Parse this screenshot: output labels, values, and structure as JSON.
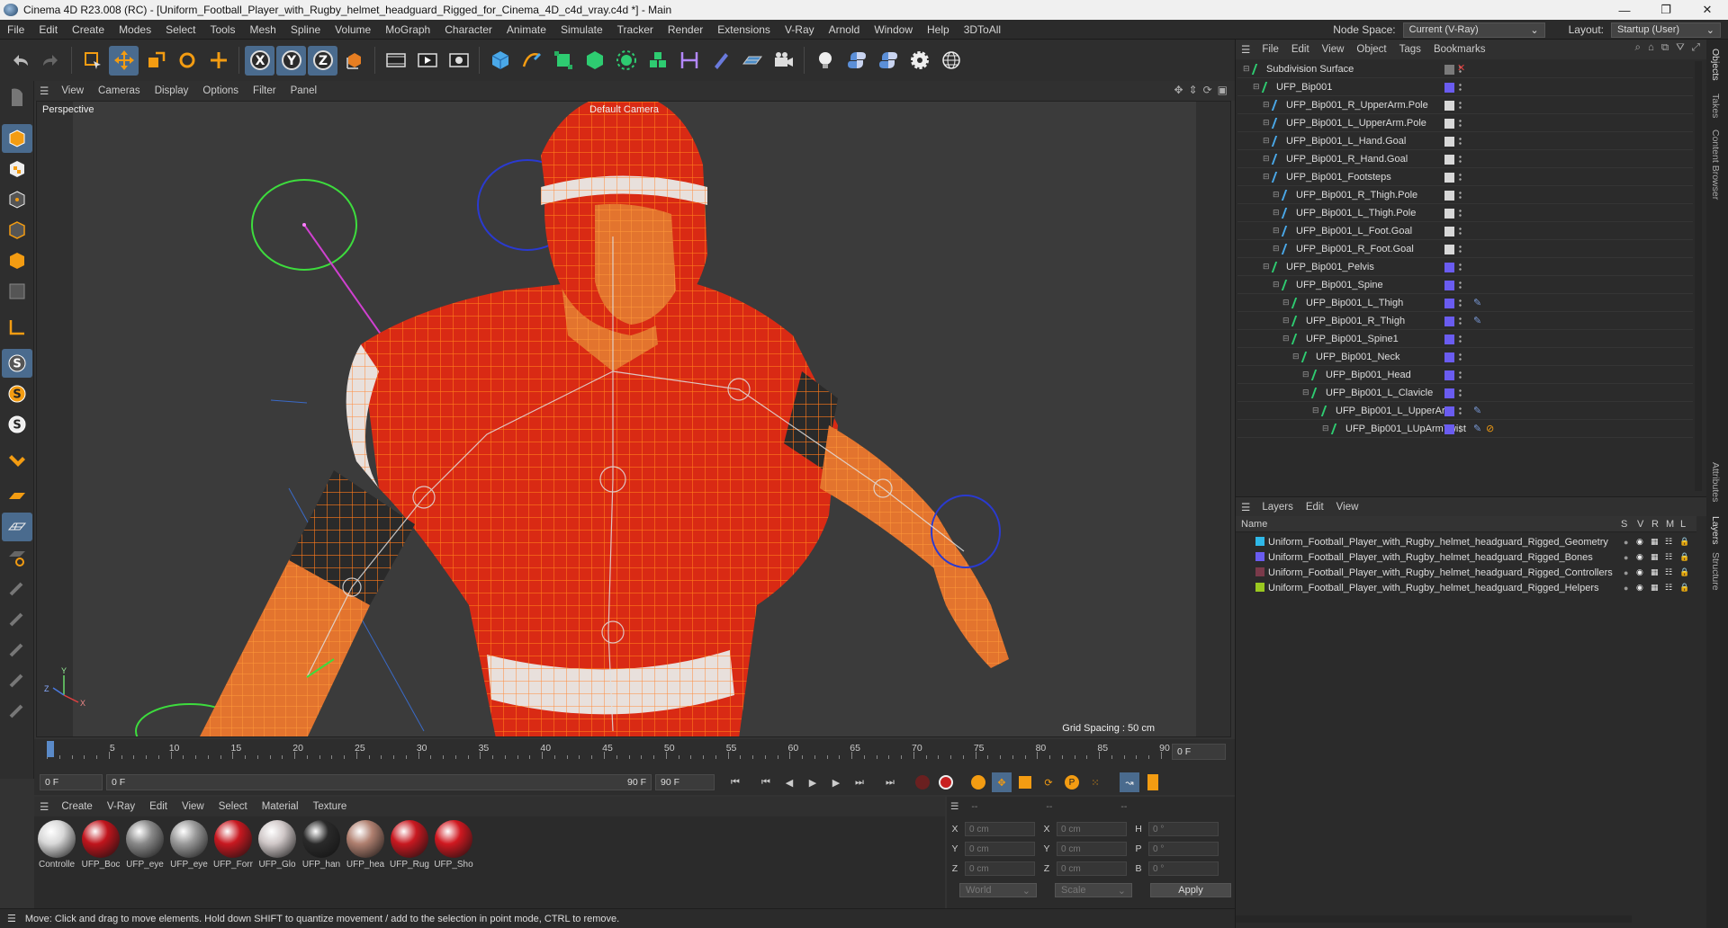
{
  "window": {
    "title": "Cinema 4D R23.008 (RC) - [Uniform_Football_Player_with_Rugby_helmet_headguard_Rigged_for_Cinema_4D_c4d_vray.c4d *] - Main"
  },
  "menu": [
    "File",
    "Edit",
    "Create",
    "Modes",
    "Select",
    "Tools",
    "Mesh",
    "Spline",
    "Volume",
    "MoGraph",
    "Character",
    "Animate",
    "Simulate",
    "Tracker",
    "Render",
    "Extensions",
    "V-Ray",
    "Arnold",
    "Window",
    "Help",
    "3DToAll"
  ],
  "node_space": {
    "label": "Node Space:",
    "value": "Current (V-Ray)"
  },
  "layout": {
    "label": "Layout:",
    "value": "Startup (User)"
  },
  "viewport": {
    "menu": [
      "View",
      "Cameras",
      "Display",
      "Options",
      "Filter",
      "Panel"
    ],
    "label": "Perspective",
    "camera": "Default Camera",
    "grid_spacing": "Grid Spacing : 50 cm",
    "axis_x": "X",
    "axis_y": "Y",
    "axis_z": "Z"
  },
  "timeline": {
    "ticks": [
      "0",
      "5",
      "10",
      "15",
      "20",
      "25",
      "30",
      "35",
      "40",
      "45",
      "50",
      "55",
      "60",
      "65",
      "70",
      "75",
      "80",
      "85",
      "90"
    ],
    "current_frame": "0 F",
    "start": "0 F",
    "preview_start": "0 F",
    "preview_end": "90 F",
    "end": "90 F"
  },
  "materials": {
    "menu": [
      "Create",
      "V-Ray",
      "Edit",
      "View",
      "Select",
      "Material",
      "Texture"
    ],
    "items": [
      {
        "label": "Controlle",
        "color": "#d8d8d8"
      },
      {
        "label": "UFP_Boc",
        "color": "#c0141c"
      },
      {
        "label": "UFP_eye",
        "color": "#8a8a8a"
      },
      {
        "label": "UFP_eye",
        "color": "#9a9a9a"
      },
      {
        "label": "UFP_Forr",
        "color": "#c81820"
      },
      {
        "label": "UFP_Glo",
        "color": "#d0c8c8"
      },
      {
        "label": "UFP_han",
        "color": "#2a2a2a"
      },
      {
        "label": "UFP_hea",
        "color": "#b08070"
      },
      {
        "label": "UFP_Rug",
        "color": "#c81820"
      },
      {
        "label": "UFP_Sho",
        "color": "#d01820"
      }
    ]
  },
  "coords": {
    "header": [
      "--",
      "--",
      "--"
    ],
    "rows": [
      {
        "a": "X",
        "av": "0 cm",
        "b": "X",
        "bv": "0 cm",
        "c": "H",
        "cv": "0 °"
      },
      {
        "a": "Y",
        "av": "0 cm",
        "b": "Y",
        "bv": "0 cm",
        "c": "P",
        "cv": "0 °"
      },
      {
        "a": "Z",
        "av": "0 cm",
        "b": "Z",
        "bv": "0 cm",
        "c": "B",
        "cv": "0 °"
      }
    ],
    "world": "World",
    "scale": "Scale",
    "apply": "Apply"
  },
  "status": "Move: Click and drag to move elements. Hold down SHIFT to quantize movement / add to the selection in point mode, CTRL to remove.",
  "objects": {
    "menu": [
      "File",
      "Edit",
      "View",
      "Object",
      "Tags",
      "Bookmarks"
    ],
    "rows": [
      {
        "name": "Subdivision Surface",
        "indent": 0,
        "color": "#7a7a7a",
        "tag": "",
        "hl": false
      },
      {
        "name": "UFP_Bip001",
        "indent": 1,
        "color": "#6a5cf0",
        "tag": "",
        "hl": false
      },
      {
        "name": "UFP_Bip001_R_UpperArm.Pole",
        "indent": 2,
        "color": "#d8d8d8",
        "tag": "",
        "hl": false
      },
      {
        "name": "UFP_Bip001_L_UpperArm.Pole",
        "indent": 2,
        "color": "#d8d8d8",
        "tag": "",
        "hl": false
      },
      {
        "name": "UFP_Bip001_L_Hand.Goal",
        "indent": 2,
        "color": "#d8d8d8",
        "tag": "",
        "hl": false
      },
      {
        "name": "UFP_Bip001_R_Hand.Goal",
        "indent": 2,
        "color": "#d8d8d8",
        "tag": "",
        "hl": false
      },
      {
        "name": "UFP_Bip001_Footsteps",
        "indent": 2,
        "color": "#d8d8d8",
        "tag": "",
        "hl": false
      },
      {
        "name": "UFP_Bip001_R_Thigh.Pole",
        "indent": 3,
        "color": "#d8d8d8",
        "tag": "",
        "hl": false
      },
      {
        "name": "UFP_Bip001_L_Thigh.Pole",
        "indent": 3,
        "color": "#d8d8d8",
        "tag": "",
        "hl": false
      },
      {
        "name": "UFP_Bip001_L_Foot.Goal",
        "indent": 3,
        "color": "#d8d8d8",
        "tag": "",
        "hl": false
      },
      {
        "name": "UFP_Bip001_R_Foot.Goal",
        "indent": 3,
        "color": "#d8d8d8",
        "tag": "",
        "hl": false
      },
      {
        "name": "UFP_Bip001_Pelvis",
        "indent": 2,
        "color": "#6a5cf0",
        "tag": "",
        "hl": false
      },
      {
        "name": "UFP_Bip001_Spine",
        "indent": 3,
        "color": "#6a5cf0",
        "tag": "",
        "hl": false
      },
      {
        "name": "UFP_Bip001_L_Thigh",
        "indent": 4,
        "color": "#6a5cf0",
        "tag": "ik",
        "hl": false
      },
      {
        "name": "UFP_Bip001_R_Thigh",
        "indent": 4,
        "color": "#6a5cf0",
        "tag": "ik",
        "hl": false
      },
      {
        "name": "UFP_Bip001_Spine1",
        "indent": 4,
        "color": "#6a5cf0",
        "tag": "",
        "hl": false
      },
      {
        "name": "UFP_Bip001_Neck",
        "indent": 5,
        "color": "#6a5cf0",
        "tag": "",
        "hl": false
      },
      {
        "name": "UFP_Bip001_Head",
        "indent": 6,
        "color": "#6a5cf0",
        "tag": "",
        "hl": false
      },
      {
        "name": "UFP_Bip001_L_Clavicle",
        "indent": 6,
        "color": "#6a5cf0",
        "tag": "",
        "hl": false
      },
      {
        "name": "UFP_Bip001_L_UpperArm",
        "indent": 7,
        "color": "#6a5cf0",
        "tag": "ik",
        "hl": false
      },
      {
        "name": "UFP_Bip001_LUpArmTwist",
        "indent": 8,
        "color": "#6a5cf0",
        "tag": "ik2",
        "hl": false
      }
    ]
  },
  "layers": {
    "menu": [
      "Layers",
      "Edit",
      "View"
    ],
    "head": {
      "name": "Name",
      "cols": [
        "S",
        "V",
        "R",
        "M",
        "L"
      ]
    },
    "rows": [
      {
        "name": "Uniform_Football_Player_with_Rugby_helmet_headguard_Rigged_Geometry",
        "color": "#2fb8e8"
      },
      {
        "name": "Uniform_Football_Player_with_Rugby_helmet_headguard_Rigged_Bones",
        "color": "#6a5cf0"
      },
      {
        "name": "Uniform_Football_Player_with_Rugby_helmet_headguard_Rigged_Controllers",
        "color": "#7a3a4a"
      },
      {
        "name": "Uniform_Football_Player_with_Rugby_helmet_headguard_Rigged_Helpers",
        "color": "#9ac820"
      }
    ]
  },
  "side_tabs": [
    "Objects",
    "Takes",
    "Content Browser",
    "Attributes",
    "Layers",
    "Structure"
  ]
}
